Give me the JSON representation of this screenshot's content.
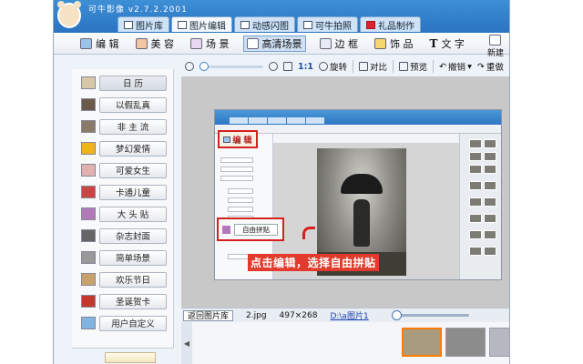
{
  "app": {
    "title": "可牛影像 v2.7.2.2001"
  },
  "tabs": [
    {
      "label": "图片库",
      "icon": "photo-library-icon"
    },
    {
      "label": "图片编辑",
      "icon": "image-edit-icon",
      "active": true
    },
    {
      "label": "动感闪图",
      "icon": "flash-icon"
    },
    {
      "label": "可牛拍照",
      "icon": "camera-icon"
    },
    {
      "label": "礼品制作",
      "icon": "gift-icon"
    }
  ],
  "tools": [
    {
      "label": "编 辑",
      "icon": "edit-icon"
    },
    {
      "label": "美 容",
      "icon": "beauty-icon"
    },
    {
      "label": "场 景",
      "icon": "scene-icon"
    },
    {
      "label": "高清场景",
      "icon": "hd-scene-icon",
      "active": true
    },
    {
      "label": "边 框",
      "icon": "frame-icon"
    },
    {
      "label": "饰 品",
      "icon": "decoration-icon"
    },
    {
      "label": "文 字",
      "icon": "text-icon"
    }
  ],
  "new_button": "新建",
  "edit_toolbar": {
    "zoom_ratio": "1:1",
    "rotate": "旋转",
    "contrast": "对比",
    "preview": "预览",
    "undo": "撤销",
    "redo": "重做"
  },
  "sidebar": [
    {
      "label": "日 历",
      "active": true
    },
    {
      "label": "以假乱真"
    },
    {
      "label": "非 主 流"
    },
    {
      "label": "梦幻爱情"
    },
    {
      "label": "可爱女生"
    },
    {
      "label": "卡通儿童"
    },
    {
      "label": "大 头 贴"
    },
    {
      "label": "杂志封面"
    },
    {
      "label": "简单场景"
    },
    {
      "label": "欢乐节日"
    },
    {
      "label": "圣诞贺卡"
    },
    {
      "label": "用户自定义"
    }
  ],
  "inner_screenshot": {
    "edit_label": "编 辑",
    "free_collage": "自由拼贴",
    "caption": "点击编辑，选择自由拼贴"
  },
  "statusbar": {
    "back": "返回图片库",
    "filename": "2.jpg",
    "dimensions": "497×268",
    "path": "D:\\a图片1"
  }
}
